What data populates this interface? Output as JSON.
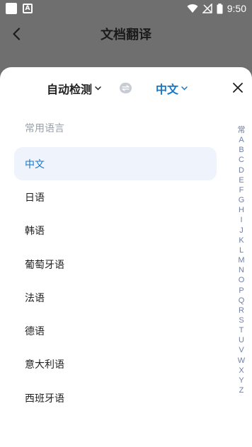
{
  "status_bar": {
    "time": "9:50",
    "notification_icons": [
      "square-icon",
      "a-icon"
    ],
    "system_icons": [
      "wifi-icon",
      "no-signal-icon",
      "battery-icon"
    ]
  },
  "header": {
    "title": "文档翻译",
    "back_icon": "chevron-left-icon"
  },
  "language_bar": {
    "source": "自动检测",
    "target": "中文",
    "swap_icon": "swap-icon",
    "close_icon": "close-icon"
  },
  "section_label": "常用语言",
  "languages": [
    {
      "label": "中文",
      "selected": true
    },
    {
      "label": "日语",
      "selected": false
    },
    {
      "label": "韩语",
      "selected": false
    },
    {
      "label": "葡萄牙语",
      "selected": false
    },
    {
      "label": "法语",
      "selected": false
    },
    {
      "label": "德语",
      "selected": false
    },
    {
      "label": "意大利语",
      "selected": false
    },
    {
      "label": "西班牙语",
      "selected": false
    }
  ],
  "index_letters": [
    "常",
    "A",
    "B",
    "C",
    "D",
    "E",
    "F",
    "G",
    "H",
    "I",
    "J",
    "K",
    "L",
    "M",
    "N",
    "O",
    "P",
    "Q",
    "R",
    "S",
    "T",
    "U",
    "V",
    "W",
    "X",
    "Y",
    "Z"
  ],
  "colors": {
    "accent": "#1677c9",
    "selected_bg": "#eef3fc",
    "overlay": "#6f6f6f"
  }
}
